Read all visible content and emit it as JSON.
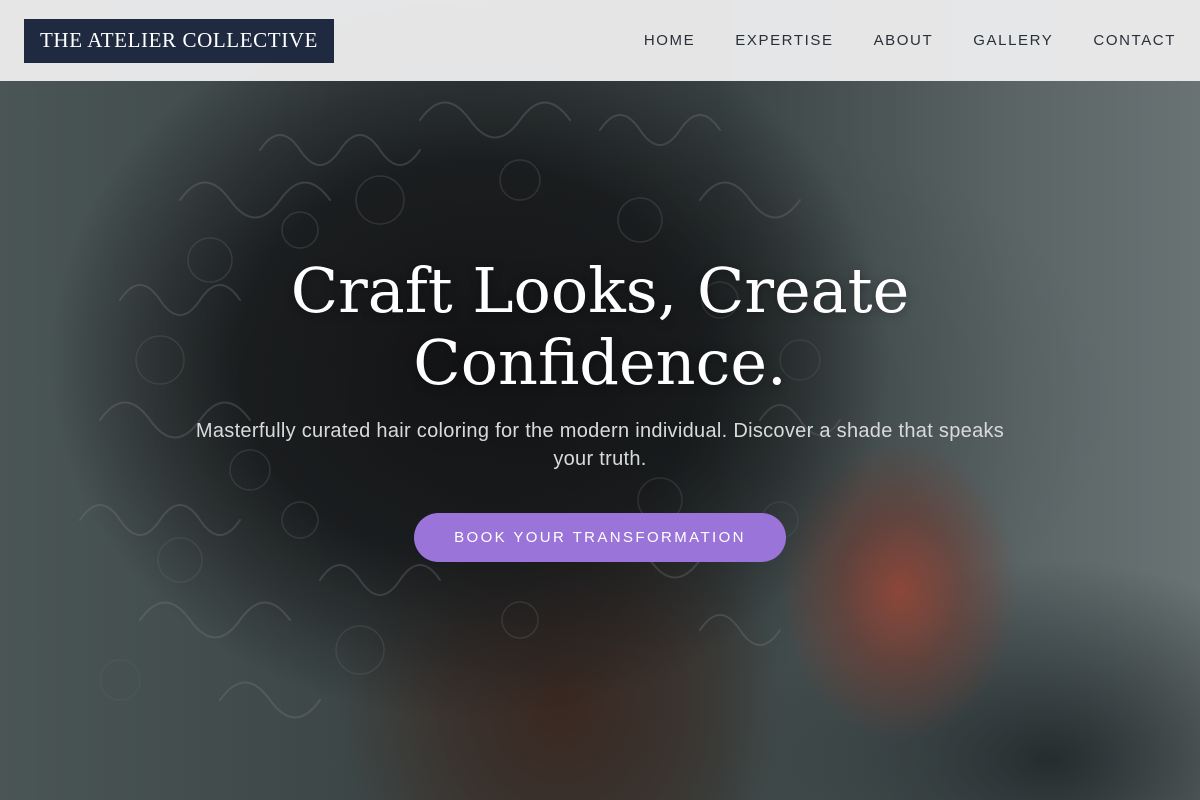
{
  "brand": {
    "name": "THE ATELIER COLLECTIVE"
  },
  "nav": {
    "items": [
      {
        "label": "HOME"
      },
      {
        "label": "EXPERTISE"
      },
      {
        "label": "ABOUT"
      },
      {
        "label": "GALLERY"
      },
      {
        "label": "CONTACT"
      }
    ]
  },
  "hero": {
    "headline": "Craft Looks, Create Confidence.",
    "subtext": "Masterfully curated hair coloring for the modern individual. Discover a shade that speaks your truth.",
    "cta_label": "BOOK YOUR TRANSFORMATION"
  },
  "colors": {
    "header_bg": "#ececed",
    "logo_bg": "#1f2a40",
    "cta_bg": "#9a74d9",
    "text_light": "#ffffff"
  }
}
